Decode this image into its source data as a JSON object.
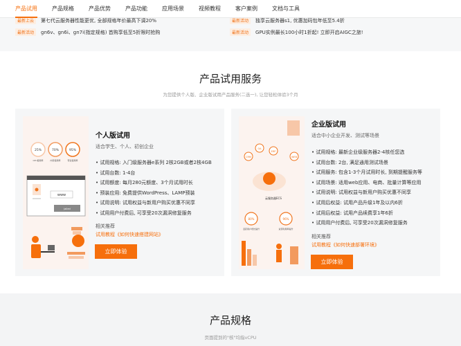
{
  "nav": [
    "产品试用",
    "产品规格",
    "产品优势",
    "产品功能",
    "应用场景",
    "视频教程",
    "客户案例",
    "文档与工具"
  ],
  "news": [
    {
      "tag": "最新上云",
      "text": "第七代云服务器性能更优, 全部规格年价最高下调20%"
    },
    {
      "tag": "最新活动",
      "text": "独享云服务器s1, 优惠加码包年低至5.4折"
    },
    {
      "tag": "最新活动",
      "text": "gn6v、gn6i、gn7i(指定规格) 首购享低至5折限时抢购"
    },
    {
      "tag": "最新活动",
      "text": "GPU实例最长100小时1折起! 立即开启AIGC之旅!"
    }
  ],
  "section": {
    "title": "产品试用服务",
    "subtitle": "为您提供个人版、企业版试用产品服务(二选一), 让您轻松体验3个月"
  },
  "personal": {
    "title": "个人版试用",
    "desc": "适合学生、个人、初创企业",
    "items": [
      "试用规格: 入门级服务器e系列 2核2GB或者2核4GB",
      "试用台数: 1-4台",
      "试用额度: 每月280元额度、3个月试用时长",
      "预装应用: 免费提供WordPress、LAMP预装",
      "试用说明: 试用权益与新用户购买优惠不同享",
      "试用用户付费后, 可享受20次漏洞修复服务"
    ],
    "rec_label": "相关推荐",
    "rec_link": "试用教程《如何快速搭建网站》",
    "button": "立即体验",
    "illu": {
      "stats": [
        "25%",
        "70%",
        "95%"
      ],
      "stat_labels": [
        "CPU使用率",
        "内存使用率",
        "带宽使用率"
      ],
      "www": "www",
      "input": "Jailed"
    }
  },
  "enterprise": {
    "title": "企业版试用",
    "desc": "适合中小企业开发、测试等场景",
    "items": [
      "试用规格: 最新企业级服务器2-4核任您选",
      "试用台数: 2台, 满足通用测试场景",
      "试用服务: 包含1-3个月试用时长, 到期提醒服务等",
      "试用场景: 适用web应用、电商、批量计算等应用",
      "试用说明: 试用权益与新用户购买优惠不同享",
      "试用后权益: 试用产品升级1年及以内6折",
      "试用后权益: 试用产品续费享1年6折",
      "试用用户付费后, 可享受20次漏洞修复服务"
    ],
    "rec_label": "相关推荐",
    "rec_link": "试用教程《如何快速部署环境》",
    "button": "立即体验",
    "illu": {
      "labels": [
        "CRM",
        "OA",
        "ERP",
        "WEB"
      ],
      "ecs": "云服务器ECS",
      "pct1": "80%",
      "pct2": "96%",
      "sub1": "活跃用户增长提升",
      "sub2": "资源利用率提升"
    }
  },
  "specs": {
    "title": "产品规格",
    "subtitle": "页面提到的\"核\"均指vCPU"
  },
  "colors": {
    "accent": "#f66f0c",
    "tag_bg": "#fdeee2"
  }
}
